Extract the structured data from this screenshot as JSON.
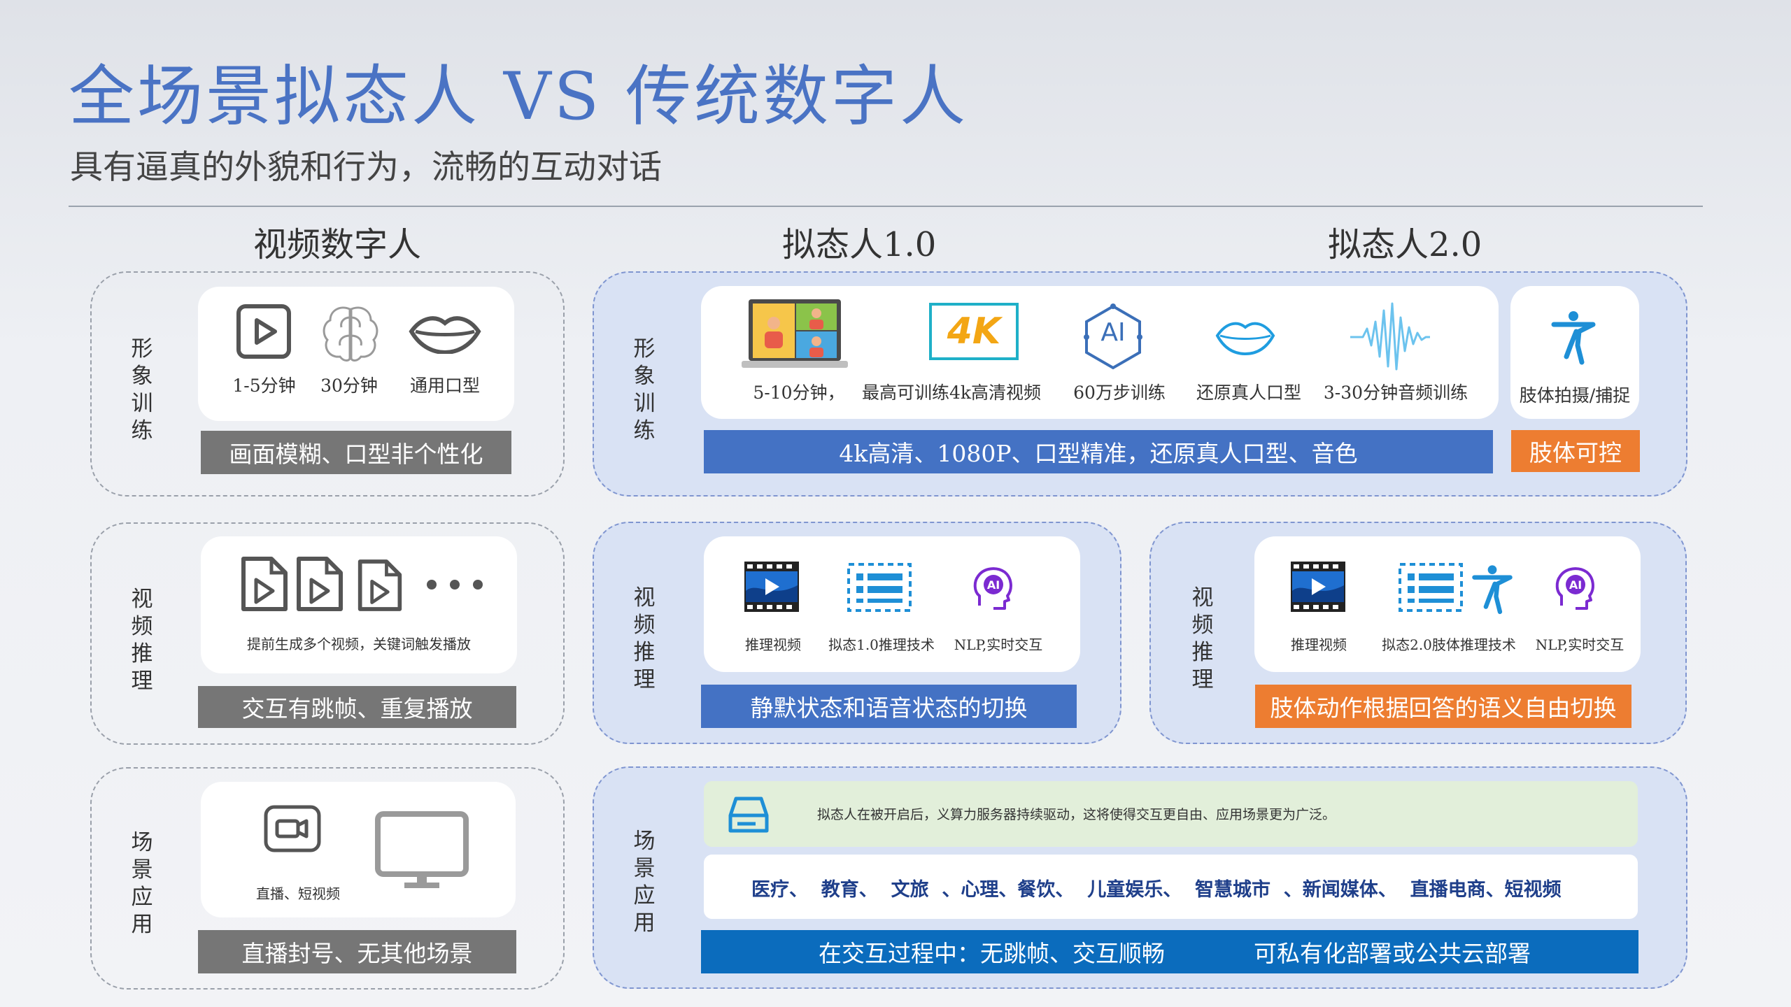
{
  "title": "全场景拟态人 VS 传统数字人",
  "subtitle": "具有逼真的外貌和行为，流畅的互动对话",
  "columns": [
    "视频数字人",
    "拟态人1.0",
    "拟态人2.0"
  ],
  "rows": {
    "image_training": "形象训练",
    "video_inference": "视频推理",
    "scenario_application": "场景应用"
  },
  "video_human": {
    "training_items": [
      "1-5分钟",
      "30分钟",
      "通用口型"
    ],
    "training_bar": "画面模糊、口型非个性化",
    "inference_caption": "提前生成多个视频，关键词触发播放",
    "inference_bar": "交互有跳帧、重复播放",
    "scenario_caption": "直播、短视频",
    "scenario_bar": "直播封号、无其他场景"
  },
  "mimic": {
    "training_items": [
      "5-10分钟，",
      "最高可训练4k高清视频",
      "60万步训练",
      "还原真人口型",
      "3-30分钟音频训练"
    ],
    "training_extra": "肢体拍摄/捕捉",
    "training_bar": "4k高清、1080P、口型精准，还原真人口型、音色",
    "training_extra_bar": "肢体可控",
    "v1_inference_items": [
      "推理视频",
      "拟态1.0推理技术",
      "NLP,实时交互"
    ],
    "v1_inference_bar": "静默状态和语音状态的切换",
    "v2_inference_items": [
      "推理视频",
      "拟态2.0肢体推理技术",
      "NLP,实时交互"
    ],
    "v2_inference_bar": "肢体动作根据回答的语义自由切换",
    "scenario_note": "拟态人在被开启后，义算力服务器持续驱动，这将使得交互更自由、应用场景更为广泛。",
    "scenario_list": "医疗、  教育、  文旅  、心理、餐饮、  儿童娱乐、  智慧城市  、新闻媒体、  直播电商、短视频",
    "scenario_bar_left": "在交互过程中：无跳帧、交互顺畅",
    "scenario_bar_right": "可私有化部署或公共云部署"
  },
  "icons": {
    "four_k": "4K",
    "ai": "AI"
  },
  "colors": {
    "title_blue": "#4a73c4",
    "bar_gray": "#767676",
    "bar_blue": "#4472c4",
    "bar_orange": "#ed7d31",
    "bar_dark_blue": "#0b6cbd",
    "panel_blue": "#d9e2f4",
    "note_green": "#e2efda"
  }
}
